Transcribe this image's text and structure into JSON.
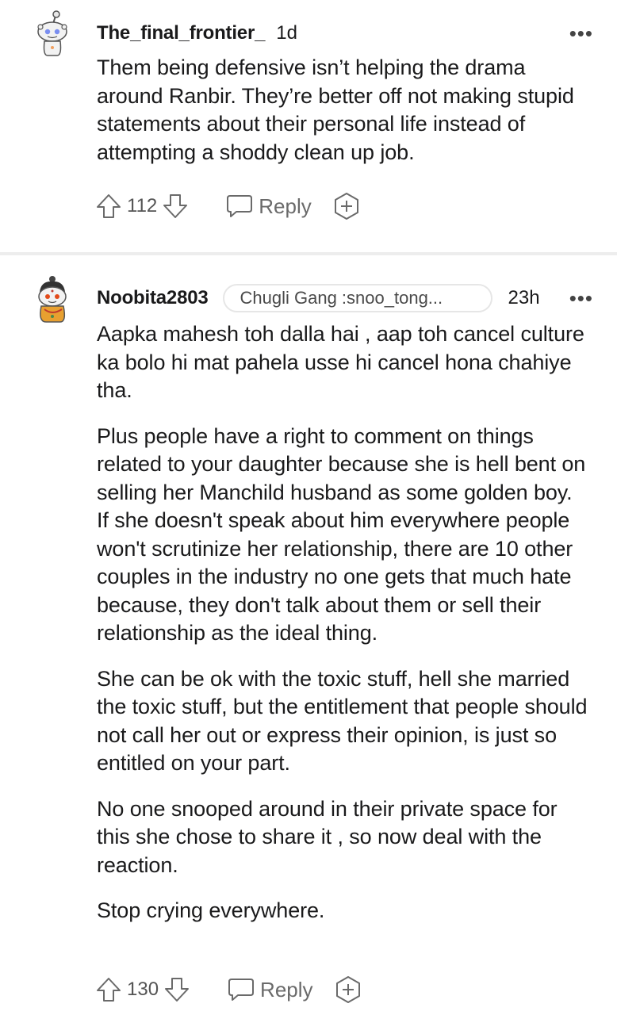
{
  "comments": [
    {
      "username": "The_final_frontier_",
      "time": "1d",
      "more": "•••",
      "paragraphs": [
        "Them being defensive isn’t helping the drama around Ranbir. They’re better off not making stupid statements about their personal life instead of attempting a shoddy clean up job."
      ],
      "score": "112",
      "reply_label": "Reply",
      "avatar_icon": "snoo-avatar-icon"
    },
    {
      "username": "Noobita2803",
      "flair": "Chugli Gang :snoo_tong...",
      "time": "23h",
      "more": "•••",
      "paragraphs": [
        "Aapka mahesh toh dalla hai , aap toh cancel culture ka bolo hi mat pahela usse hi cancel hona chahiye tha.",
        "Plus people have a right to comment on things related to your daughter because she is hell bent on selling her Manchild husband as some golden boy. If she doesn't speak about him everywhere people won't scrutinize her relationship, there are 10 other couples in the industry no one gets that much hate because, they don't talk about them or sell their relationship as the ideal thing.",
        "She can be ok with the toxic stuff, hell she married the toxic stuff, but the entitlement that people should not call her out or express their opinion, is just so entitled on your part.",
        "No one snooped around in their private space for this she chose to share it , so now deal with the reaction.",
        "Stop crying everywhere."
      ],
      "score": "130",
      "reply_label": "Reply",
      "avatar_icon": "snoo-avatar-icon"
    }
  ],
  "colors": {
    "text": "#1a1a1b",
    "muted": "#6a6a6a",
    "divider": "#ededed"
  }
}
